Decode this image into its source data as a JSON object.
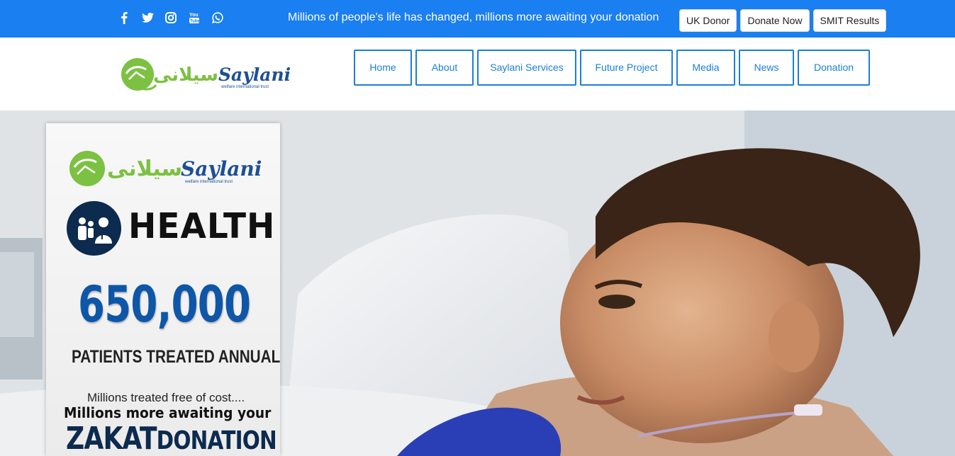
{
  "topbar": {
    "social_icons": [
      "facebook-icon",
      "twitter-icon",
      "instagram-icon",
      "youtube-icon",
      "whatsapp-icon"
    ],
    "tagline": "Millions of people's life has changed, millions more awaiting your donation",
    "buttons": [
      "UK Donor",
      "Donate Now",
      "SMIT Results"
    ],
    "color": "#1a7ff0"
  },
  "header": {
    "logo_text": "Saylani",
    "logo_urdu": "سیلانی",
    "logo_tagline": "welfare international trust",
    "nav": [
      "Home",
      "About",
      "Saylani Services",
      "Future Project",
      "Media",
      "News",
      "Donation"
    ],
    "nav_color": "#1b7fd8"
  },
  "card": {
    "logo_text": "Saylani",
    "logo_urdu": "سیلانی",
    "logo_tagline": "welfare international trust",
    "health_title": "HEALTH",
    "big_number": "650,000",
    "sub_number": "PATIENTS TREATED ANNUALLY",
    "line1": "Millions treated free of cost....",
    "line2": "Millions more awaiting your",
    "zakat": "ZAKAT",
    "donation": "DONATION"
  }
}
